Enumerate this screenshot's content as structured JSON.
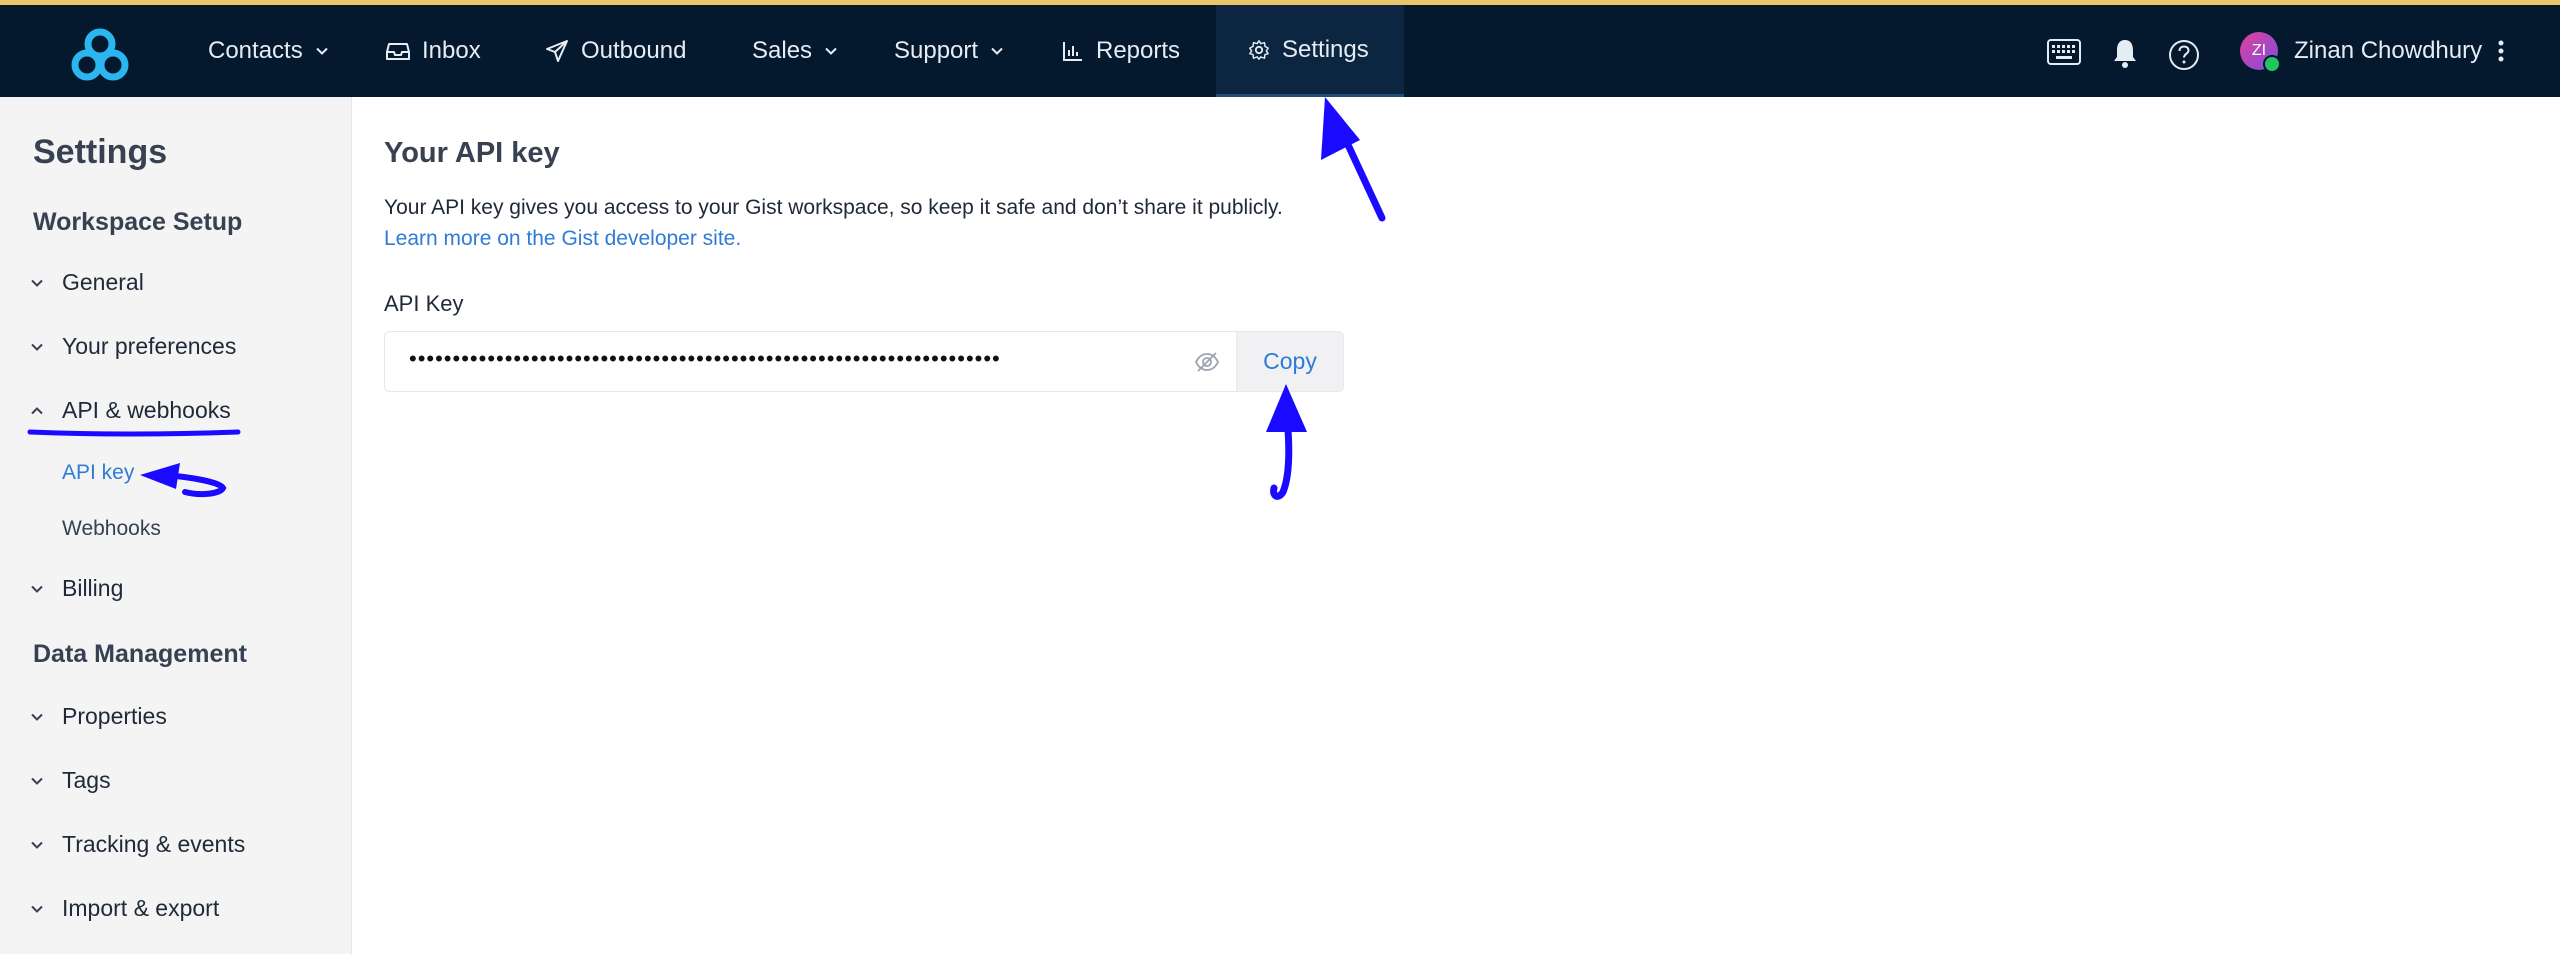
{
  "nav": {
    "items": [
      {
        "label": "Contacts",
        "icon": "none",
        "has_dropdown": true
      },
      {
        "label": "Inbox",
        "icon": "inbox-icon",
        "has_dropdown": false
      },
      {
        "label": "Outbound",
        "icon": "paper-plane-icon",
        "has_dropdown": false
      },
      {
        "label": "Sales",
        "icon": "none",
        "has_dropdown": true
      },
      {
        "label": "Support",
        "icon": "none",
        "has_dropdown": true
      },
      {
        "label": "Reports",
        "icon": "bar-chart-icon",
        "has_dropdown": false
      },
      {
        "label": "Settings",
        "icon": "gear-icon",
        "has_dropdown": false,
        "active": true
      }
    ],
    "right_icons": [
      "keyboard-icon",
      "bell-icon",
      "help-circle-icon"
    ],
    "user": {
      "initials": "ZI",
      "name": "Zinan Chowdhury",
      "status": "online"
    }
  },
  "sidebar": {
    "title": "Settings",
    "sections": [
      {
        "heading": "Workspace Setup",
        "items": [
          {
            "label": "General",
            "expanded": false
          },
          {
            "label": "Your preferences",
            "expanded": false
          },
          {
            "label": "API & webhooks",
            "expanded": true,
            "children": [
              {
                "label": "API key",
                "active": true
              },
              {
                "label": "Webhooks",
                "active": false
              }
            ]
          },
          {
            "label": "Billing",
            "expanded": false
          }
        ]
      },
      {
        "heading": "Data Management",
        "items": [
          {
            "label": "Properties",
            "expanded": false
          },
          {
            "label": "Tags",
            "expanded": false
          },
          {
            "label": "Tracking & events",
            "expanded": false
          },
          {
            "label": "Import & export",
            "expanded": false
          }
        ]
      }
    ]
  },
  "main": {
    "title": "Your API key",
    "description": "Your API key gives you access to your Gist workspace, so keep it safe and don’t share it publicly.",
    "learn_more": "Learn more on the Gist developer site.",
    "field_label": "API Key",
    "api_key_masked": "••••••••••••••••••••••••••••••••••••••••••••••••••••••••••••••••••••",
    "copy_label": "Copy"
  },
  "colors": {
    "nav_bg": "#04182e",
    "accent_link": "#2f7bd6",
    "annotation": "#1a0aff",
    "logo": "#2bb6f0"
  }
}
